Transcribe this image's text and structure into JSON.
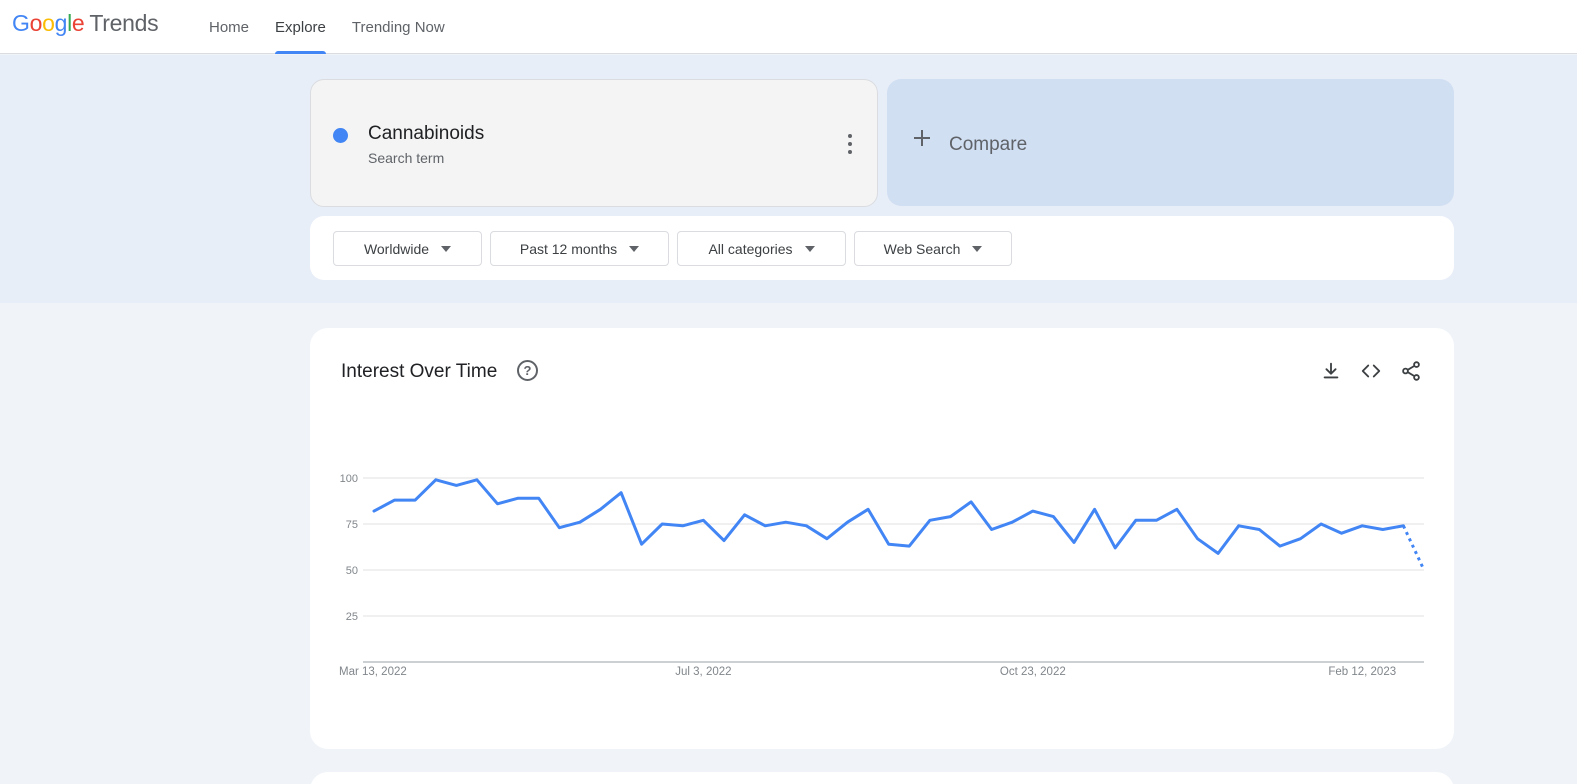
{
  "header": {
    "logo": {
      "google": [
        "G",
        "o",
        "o",
        "g",
        "l",
        "e"
      ],
      "trends": "Trends"
    },
    "nav": [
      {
        "label": "Home",
        "active": false
      },
      {
        "label": "Explore",
        "active": true
      },
      {
        "label": "Trending Now",
        "active": false
      }
    ]
  },
  "term": {
    "name": "Cannabinoids",
    "type": "Search term",
    "color": "#4285f4"
  },
  "compare": {
    "label": "Compare"
  },
  "filters": [
    {
      "label": "Worldwide"
    },
    {
      "label": "Past 12 months"
    },
    {
      "label": "All categories"
    },
    {
      "label": "Web Search"
    }
  ],
  "chart": {
    "title": "Interest Over Time",
    "help_icon": "help-icon",
    "tools": [
      "download-icon",
      "embed-code-icon",
      "share-icon"
    ]
  },
  "chart_data": {
    "type": "line",
    "ylim": [
      0,
      100
    ],
    "yticks": [
      25,
      50,
      75,
      100
    ],
    "xtick_labels": [
      "Mar 13, 2022",
      "Jul 3, 2022",
      "Oct 23, 2022",
      "Feb 12, 2023"
    ],
    "xtick_week_index": [
      0,
      16,
      32,
      48
    ],
    "grid": true,
    "series": [
      {
        "color": "#4285f4",
        "values": [
          82,
          88,
          88,
          99,
          96,
          99,
          86,
          89,
          89,
          73,
          76,
          83,
          92,
          64,
          75,
          74,
          77,
          66,
          80,
          74,
          76,
          74,
          67,
          76,
          83,
          64,
          63,
          77,
          79,
          87,
          72,
          76,
          82,
          79,
          65,
          83,
          62,
          77,
          77,
          83,
          67,
          59,
          74,
          72,
          63,
          67,
          75,
          70,
          74,
          72,
          74,
          50
        ],
        "partial_last": true
      }
    ]
  }
}
